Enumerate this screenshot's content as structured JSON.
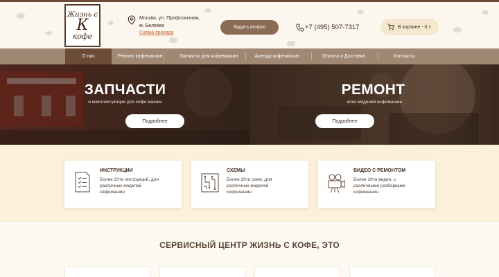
{
  "logo": {
    "top": "Жизнь с",
    "mid": "К",
    "bottom": "кофе"
  },
  "address": {
    "line1": "Москва, ул. Профсоюзная,",
    "line2": "м. Беляево",
    "map_link": "Схема проезда"
  },
  "header": {
    "ask_button": "Задать вопрос",
    "phone": "+7 (495) 507-7317",
    "cart_label": "В корзине - 0 т."
  },
  "nav": {
    "items": [
      {
        "label": "О нас"
      },
      {
        "label": "Ремонт кофемашин"
      },
      {
        "label": "Запчасти для кофемашин"
      },
      {
        "label": "Аренда кофемашин"
      },
      {
        "label": "Оплата и Доставка"
      },
      {
        "label": "Контакты"
      }
    ]
  },
  "hero": {
    "left": {
      "title": "ЗАПЧАСТИ",
      "subtitle": "и комплектующие для кофе машин",
      "button": "Подробнее"
    },
    "right": {
      "title": "РЕМОНТ",
      "subtitle": "всех моделей кофемашин",
      "button": "Подробнее"
    }
  },
  "cards": [
    {
      "title": "ИНСТРУКЦИИ",
      "line1": "Более 20ти инструкций, для",
      "line2": "различных моделей",
      "line3": "кофемашин",
      "icon": "document-checklist-icon"
    },
    {
      "title": "СХЕМЫ",
      "line1": "Более 20ти схем, для",
      "line2": "различных моделей",
      "line3": "кофемашин",
      "icon": "circuit-board-icon"
    },
    {
      "title": "ВИДЕО С РЕМОНТОМ",
      "line1": "Более 20ти видео, с",
      "line2": "различными разборками",
      "line3": "кофемашин",
      "icon": "movie-camera-icon"
    }
  ],
  "section": {
    "title": "СЕРВИСНЫЙ ЦЕНТР ЖИЗНЬ С КОФЕ, ЭТО"
  },
  "colors": {
    "brand_brown": "#6b4a36",
    "nav_bg": "#a08872",
    "accent_orange": "#c8622a",
    "cream": "#fbf0d9"
  }
}
